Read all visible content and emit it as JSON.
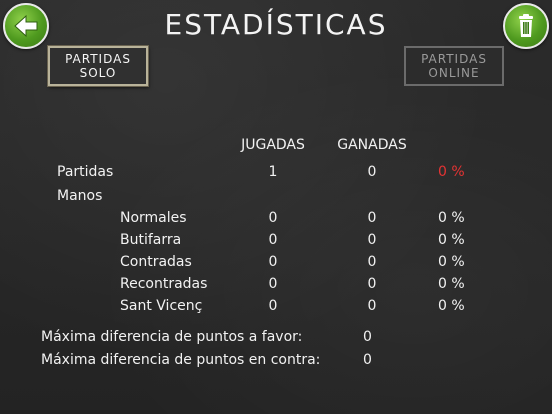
{
  "title": "ESTADÍSTICAS",
  "tabs": {
    "solo": "PARTIDAS\nSOLO",
    "online": "PARTIDAS\nONLINE"
  },
  "columns": {
    "jugadas": "JUGADAS",
    "ganadas": "GANADAS"
  },
  "rows": {
    "partidas": {
      "label": "Partidas",
      "jugadas": "1",
      "ganadas": "0",
      "pct": "0 %"
    },
    "manos": {
      "label": "Manos"
    },
    "normales": {
      "label": "Normales",
      "jugadas": "0",
      "ganadas": "0",
      "pct": "0 %"
    },
    "butifarra": {
      "label": "Butifarra",
      "jugadas": "0",
      "ganadas": "0",
      "pct": "0 %"
    },
    "contradas": {
      "label": "Contradas",
      "jugadas": "0",
      "ganadas": "0",
      "pct": "0 %"
    },
    "recontradas": {
      "label": "Recontradas",
      "jugadas": "0",
      "ganadas": "0",
      "pct": "0 %"
    },
    "sant_vicenc": {
      "label": "Sant Vicenç",
      "jugadas": "0",
      "ganadas": "0",
      "pct": "0 %"
    }
  },
  "max_favor": {
    "label": "Máxima diferencia de puntos a favor:",
    "value": "0"
  },
  "max_contra": {
    "label": "Máxima diferencia de puntos en contra:",
    "value": "0"
  },
  "colors": {
    "button_green": "#4f9a1f",
    "highlight_red": "#e53333"
  },
  "icons": {
    "back": "arrow-left-icon",
    "trash": "trash-icon"
  }
}
